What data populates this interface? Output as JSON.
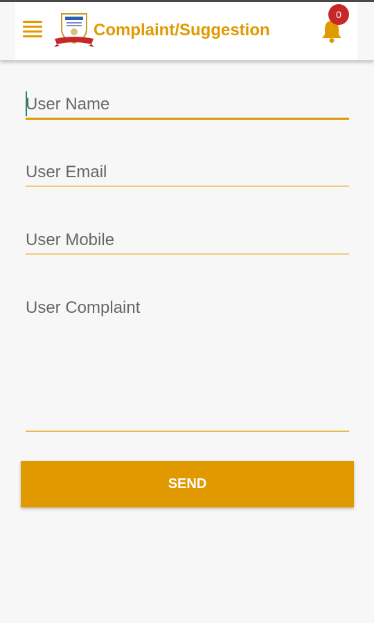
{
  "header": {
    "title": "Complaint/Suggestion",
    "menu_icon": "hamburger-menu-icon",
    "logo": "institution-logo",
    "notification_icon": "bell-icon",
    "notification_count": "0"
  },
  "form": {
    "fields": [
      {
        "placeholder": "User Name",
        "focused": true
      },
      {
        "placeholder": "User Email",
        "focused": false
      },
      {
        "placeholder": "User Mobile",
        "focused": false
      },
      {
        "placeholder": "User Complaint",
        "focused": false
      }
    ],
    "submit_label": "SEND"
  },
  "colors": {
    "accent": "#e09a00",
    "badge": "#c62828",
    "background": "#f7f7f7",
    "cursor": "#1a8a6a"
  }
}
